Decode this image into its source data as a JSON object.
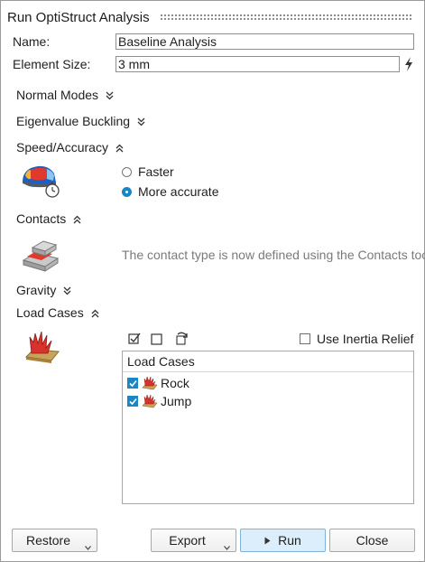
{
  "window": {
    "title": "Run OptiStruct Analysis"
  },
  "fields": {
    "name_label": "Name:",
    "name_value": "Baseline Analysis",
    "element_size_label": "Element Size:",
    "element_size_value": "3 mm"
  },
  "sections": {
    "normal_modes": "Normal Modes",
    "eigenvalue_buckling": "Eigenvalue Buckling",
    "speed_accuracy": "Speed/Accuracy",
    "contacts": "Contacts",
    "gravity": "Gravity",
    "load_cases": "Load Cases"
  },
  "speed_accuracy": {
    "options": [
      {
        "label": "Faster",
        "selected": false
      },
      {
        "label": "More accurate",
        "selected": true
      }
    ]
  },
  "contacts": {
    "note": "The contact type is now defined using the Contacts tool."
  },
  "load_cases": {
    "use_inertia_relief_label": "Use Inertia Relief",
    "use_inertia_relief_checked": false,
    "list_header": "Load Cases",
    "items": [
      {
        "label": "Rock",
        "checked": true
      },
      {
        "label": "Jump",
        "checked": true
      }
    ]
  },
  "buttons": {
    "restore": "Restore",
    "export": "Export",
    "run": "Run",
    "close": "Close"
  },
  "colors": {
    "accent": "#1a86c4",
    "run_button_bg": "#dceefb",
    "muted_text": "#7a7a7a"
  },
  "icons": {
    "lightning": "lightning-icon",
    "speed_accuracy": "speed-accuracy-icon",
    "contacts": "contacts-icon",
    "load_cases": "load-cases-icon",
    "check_all": "check-all-icon",
    "uncheck_all": "uncheck-all-icon",
    "refresh": "refresh-icon"
  }
}
